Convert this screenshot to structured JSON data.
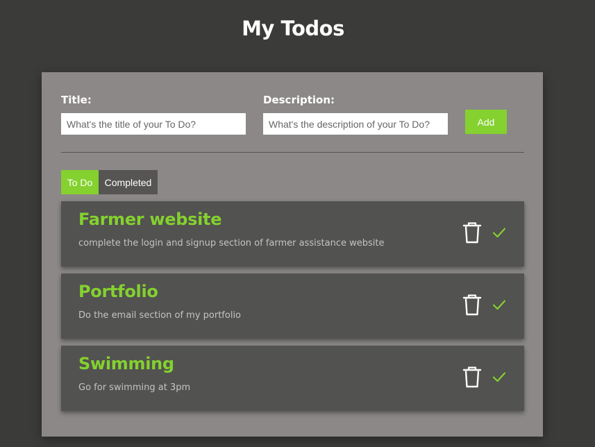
{
  "header": {
    "title": "My Todos"
  },
  "form": {
    "title_label": "Title:",
    "title_placeholder": "What's the title of your To Do?",
    "title_value": "",
    "description_label": "Description:",
    "description_placeholder": "What's the description of your To Do?",
    "description_value": "",
    "add_label": "Add"
  },
  "tabs": [
    {
      "label": "To Do",
      "active": true
    },
    {
      "label": "Completed",
      "active": false
    }
  ],
  "todos": [
    {
      "title": "Farmer website",
      "description": "complete the login and signup section of farmer assistance website"
    },
    {
      "title": "Portfolio",
      "description": "Do the email section of my portfolio"
    },
    {
      "title": "Swimming",
      "description": "Go for swimming at 3pm"
    }
  ],
  "colors": {
    "accent": "#84d12f",
    "background": "#3b3b39",
    "panel": "#8b8887",
    "card": "#525250"
  },
  "icons": {
    "delete": "trash-icon",
    "complete": "check-icon"
  }
}
